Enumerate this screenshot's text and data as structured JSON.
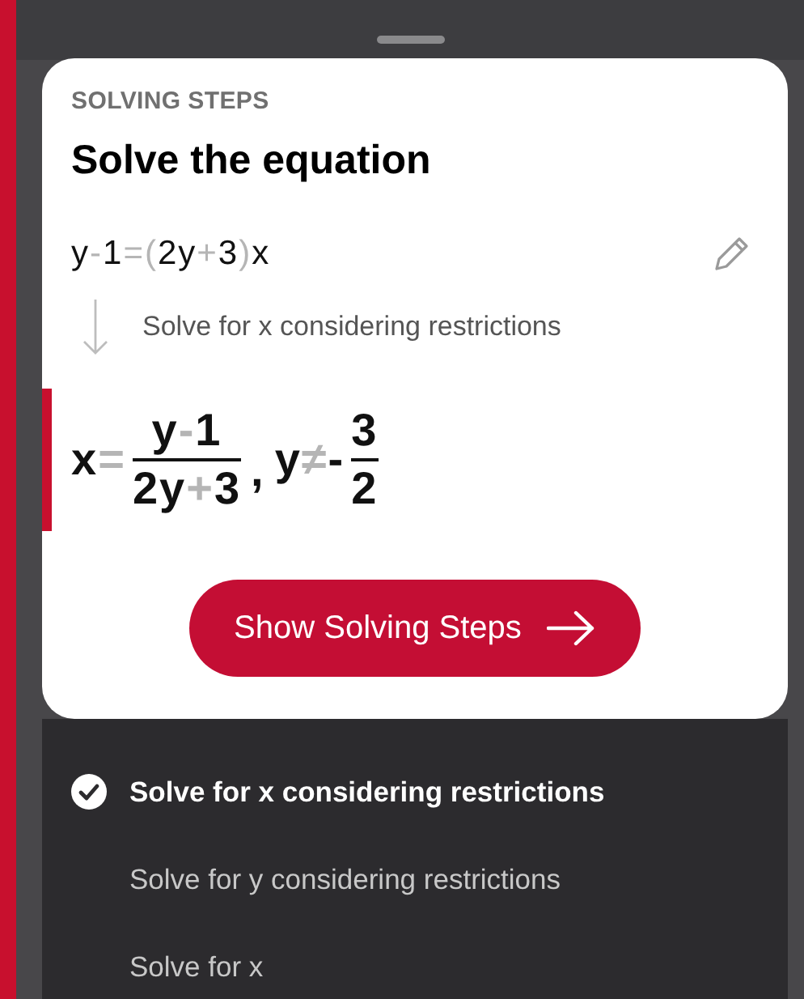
{
  "header": {
    "overline": "SOLVING STEPS",
    "title": "Solve the equation"
  },
  "equation": [
    {
      "t": "y",
      "muted": false
    },
    {
      "t": "-",
      "muted": true
    },
    {
      "t": "1",
      "muted": false
    },
    {
      "t": "=",
      "muted": true
    },
    {
      "t": "(",
      "muted": true
    },
    {
      "t": "2y",
      "muted": false
    },
    {
      "t": "+",
      "muted": true
    },
    {
      "t": "3",
      "muted": false
    },
    {
      "t": ")",
      "muted": true
    },
    {
      "t": "x",
      "muted": false
    }
  ],
  "step_label": "Solve for x considering restrictions",
  "result": {
    "lhs": [
      {
        "t": "x",
        "muted": false
      },
      {
        "t": "=",
        "muted": true
      }
    ],
    "numerator": [
      {
        "t": "y",
        "muted": false
      },
      {
        "t": "-",
        "muted": true
      },
      {
        "t": "1",
        "muted": false
      }
    ],
    "denominator": [
      {
        "t": "2y",
        "muted": false
      },
      {
        "t": "+",
        "muted": true
      },
      {
        "t": "3",
        "muted": false
      }
    ],
    "separator": ",",
    "restriction": [
      {
        "t": "y",
        "muted": false
      },
      {
        "t": "≠",
        "muted": true
      },
      {
        "t": "-",
        "muted": false
      }
    ],
    "r_numerator": "3",
    "r_denominator": "2"
  },
  "button": {
    "label": "Show Solving Steps"
  },
  "methods": [
    {
      "label": "Solve for x considering restrictions",
      "selected": true
    },
    {
      "label": "Solve for y considering restrictions",
      "selected": false
    },
    {
      "label": "Solve for x",
      "selected": false
    }
  ]
}
